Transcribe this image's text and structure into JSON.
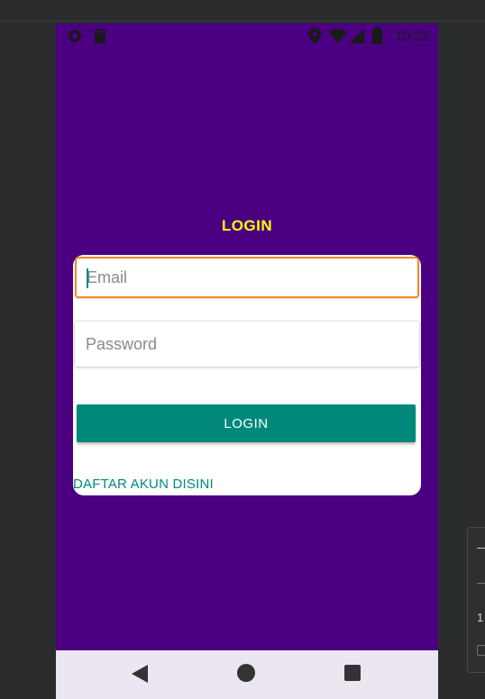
{
  "status_bar": {
    "time": "10:22",
    "icons": [
      "record-icon",
      "sd-card-icon",
      "location-icon",
      "wifi-icon",
      "signal-icon",
      "battery-icon"
    ]
  },
  "login": {
    "title": "LOGIN",
    "email_placeholder": "Email",
    "email_value": "",
    "password_placeholder": "Password",
    "password_value": "",
    "button_label": "LOGIN",
    "register_link": "DAFTAR AKUN DISINI"
  },
  "side_panel": {
    "number": "1"
  },
  "nav_bar": {
    "icons": [
      "back-icon",
      "home-icon",
      "recents-icon"
    ]
  },
  "colors": {
    "background": "#4b0082",
    "title": "#ffff00",
    "accent": "#00897b",
    "focus_border": "#f08a24",
    "card": "#ffffff",
    "nav_bar": "#ece6f3"
  }
}
